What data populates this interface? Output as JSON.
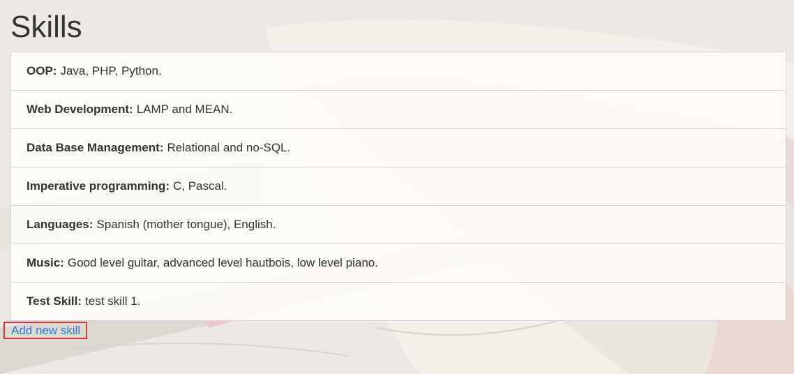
{
  "page": {
    "title": "Skills"
  },
  "skills": [
    {
      "name": "OOP:",
      "value": "Java, PHP, Python."
    },
    {
      "name": "Web Development:",
      "value": "LAMP and MEAN."
    },
    {
      "name": "Data Base Management:",
      "value": "Relational and no-SQL."
    },
    {
      "name": "Imperative programming:",
      "value": "C, Pascal."
    },
    {
      "name": "Languages:",
      "value": "Spanish (mother tongue), English."
    },
    {
      "name": "Music:",
      "value": "Good level guitar, advanced level hautbois, low level piano."
    },
    {
      "name": "Test Skill:",
      "value": "test skill 1."
    }
  ],
  "actions": {
    "add_skill_label": "Add new skill"
  },
  "colors": {
    "link": "#2a7ad6",
    "highlight_border": "#e0313d",
    "text": "#333333"
  }
}
